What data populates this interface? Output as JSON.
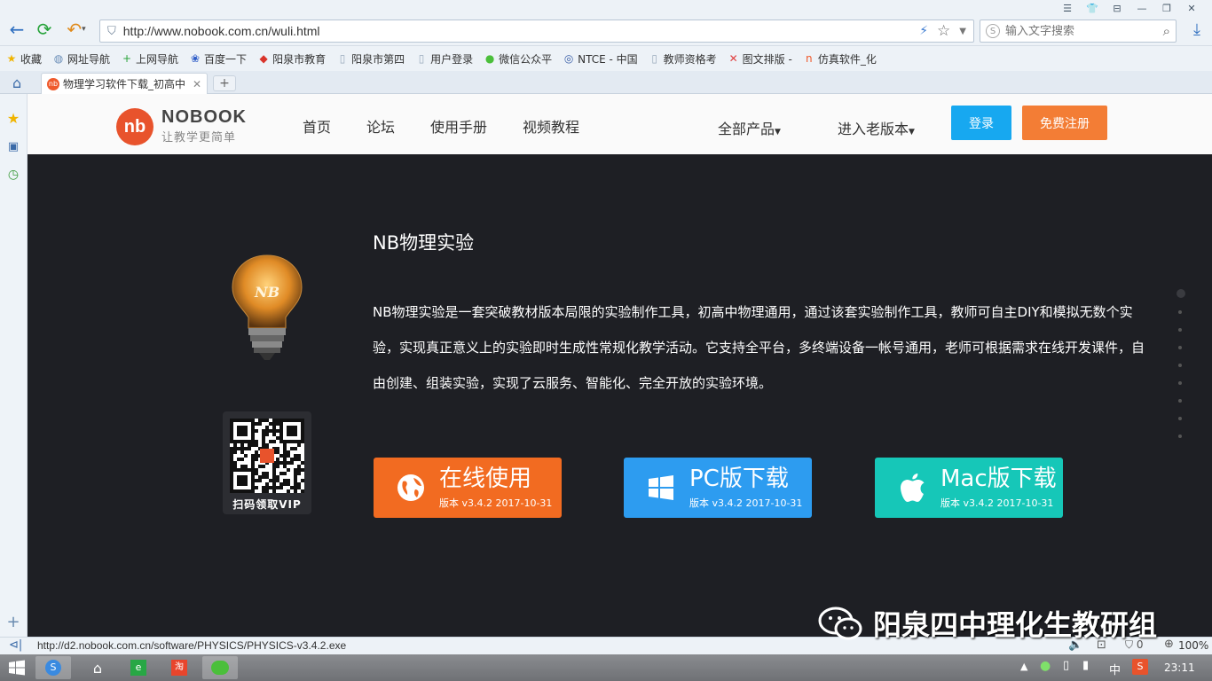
{
  "browser": {
    "url": "http://www.nobook.com.cn/wuli.html",
    "search_placeholder": "输入文字搜索",
    "bookmarks": [
      {
        "label": "收藏",
        "icon": "star-icon"
      },
      {
        "label": "网址导航",
        "icon": "globe-icon"
      },
      {
        "label": "上网导航",
        "icon": "plus-icon"
      },
      {
        "label": "百度一下",
        "icon": "paw-icon"
      },
      {
        "label": "阳泉市教育",
        "icon": "site-icon"
      },
      {
        "label": "阳泉市第四",
        "icon": "page-icon"
      },
      {
        "label": "用户登录",
        "icon": "page-icon"
      },
      {
        "label": "微信公众平",
        "icon": "wechat-icon"
      },
      {
        "label": "NTCE - 中国",
        "icon": "ntce-icon"
      },
      {
        "label": "教师资格考",
        "icon": "page-icon"
      },
      {
        "label": "图文排版 -",
        "icon": "cross-icon"
      },
      {
        "label": "仿真软件_化",
        "icon": "nb-icon"
      }
    ],
    "tab_title": "物理学习软件下载_初高中",
    "status_url": "http://d2.nobook.com.cn/software/PHYSICS/PHYSICS-v3.4.2.exe",
    "zoom": "100%"
  },
  "site": {
    "logo_mark": "nb",
    "logo_name": "NOBOOK",
    "logo_slogan": "让教学更简单",
    "nav": [
      "首页",
      "论坛",
      "使用手册",
      "视频教程"
    ],
    "all_products": "全部产品",
    "old_version": "进入老版本",
    "login": "登录",
    "register": "免费注册"
  },
  "hero": {
    "title": "NB物理实验",
    "description": "NB物理实验是一套突破教材版本局限的实验制作工具，初高中物理通用，通过该套实验制作工具，教师可自主DIY和模拟无数个实验，实现真正意义上的实验即时生成性常规化教学活动。它支持全平台，多终端设备一帐号通用，老师可根据需求在线开发课件，自由创建、组装实验，实现了云服务、智能化、完全开放的实验环境。",
    "qr_label": "扫码领取VIP",
    "bulb_text": "NB",
    "buttons": [
      {
        "label": "在线使用",
        "version": "版本 v3.4.2   2017-10-31",
        "color": "#f26b21",
        "icon": "globe-icon"
      },
      {
        "label": "PC版下载",
        "version": "版本 v3.4.2   2017-10-31",
        "color": "#2d9cf0",
        "icon": "windows-icon"
      },
      {
        "label": "Mac版下载",
        "version": "版本 v3.4.2   2017-10-31",
        "color": "#16c7b8",
        "icon": "apple-icon"
      }
    ]
  },
  "watermark": "阳泉四中理化生教研组",
  "taskbar": {
    "time": "23:11",
    "ime": "中"
  }
}
